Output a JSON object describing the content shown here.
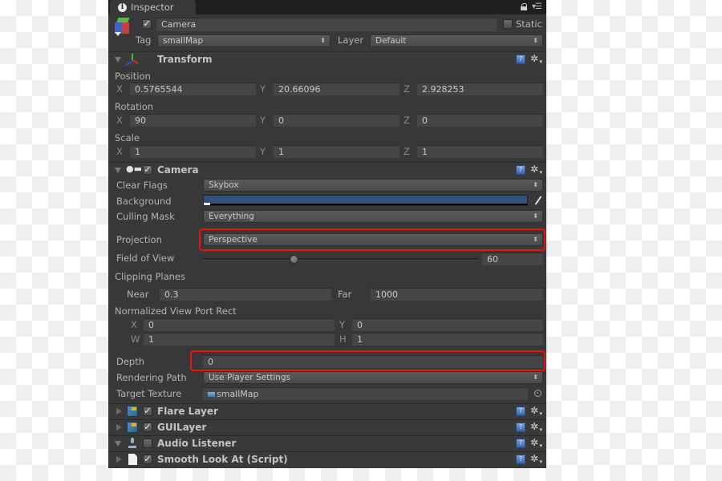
{
  "window": {
    "tab_label": "Inspector",
    "tab_icon": "info-icon",
    "lock_icon": "lock-icon",
    "menu_icon": "panel-menu-icon"
  },
  "gameobject": {
    "active": true,
    "name": "Camera",
    "static_label": "Static",
    "static_checked": false,
    "tag_label": "Tag",
    "tag_value": "smallMap",
    "layer_label": "Layer",
    "layer_value": "Default"
  },
  "transform": {
    "title": "Transform",
    "expanded": true,
    "position_label": "Position",
    "rotation_label": "Rotation",
    "scale_label": "Scale",
    "axes": [
      "X",
      "Y",
      "Z"
    ],
    "position": {
      "x": "0.5765544",
      "y": "20.66096",
      "z": "2.928253"
    },
    "rotation": {
      "x": "90",
      "y": "0",
      "z": "0"
    },
    "scale": {
      "x": "1",
      "y": "1",
      "z": "1"
    }
  },
  "camera": {
    "title": "Camera",
    "enabled": true,
    "expanded": true,
    "clear_flags_label": "Clear Flags",
    "clear_flags_value": "Skybox",
    "background_label": "Background",
    "background_color": "#31527f",
    "culling_mask_label": "Culling Mask",
    "culling_mask_value": "Everything",
    "projection_label": "Projection",
    "projection_value": "Perspective",
    "fov_label": "Field of View",
    "fov_value": "60",
    "fov_slider_fraction": 0.33,
    "clipping_planes_label": "Clipping Planes",
    "near_label": "Near",
    "near_value": "0.3",
    "far_label": "Far",
    "far_value": "1000",
    "viewport_label": "Normalized View Port Rect",
    "viewport": {
      "x_label": "X",
      "x": "0",
      "y_label": "Y",
      "y": "0",
      "w_label": "W",
      "w": "1",
      "h_label": "H",
      "h": "1"
    },
    "depth_label": "Depth",
    "depth_value": "0",
    "rendering_path_label": "Rendering Path",
    "rendering_path_value": "Use Player Settings",
    "target_texture_label": "Target Texture",
    "target_texture_value": "smallMap"
  },
  "components": [
    {
      "title": "Flare Layer",
      "enabled": true,
      "expanded": false,
      "icon": "flare-layer-icon"
    },
    {
      "title": "GUILayer",
      "enabled": true,
      "expanded": false,
      "icon": "gui-layer-icon"
    },
    {
      "title": "Audio Listener",
      "enabled": false,
      "expanded": true,
      "icon": "audio-listener-icon"
    },
    {
      "title": "Smooth Look At (Script)",
      "enabled": true,
      "expanded": false,
      "icon": "script-icon"
    }
  ],
  "highlight_color": "#ee1111",
  "icons": {
    "help": "?",
    "gear": "✲",
    "dropdown_arrows": "⇕",
    "check": "✓"
  }
}
